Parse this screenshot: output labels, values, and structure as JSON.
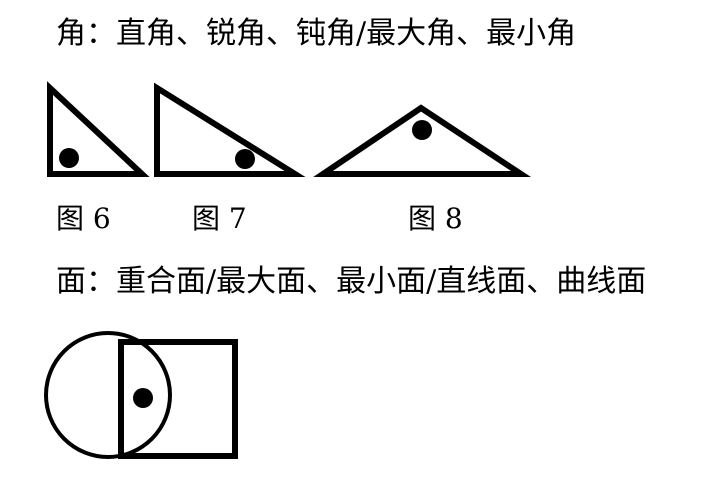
{
  "angle_line": "角：直角、锐角、钝角/最大角、最小角",
  "face_line": "面：重合面/最大面、最小面/直线面、曲线面",
  "figures": {
    "fig6": "图 6",
    "fig7": "图 7",
    "fig8": "图 8"
  },
  "colors": {
    "ink": "#000000",
    "background": "#ffffff"
  }
}
